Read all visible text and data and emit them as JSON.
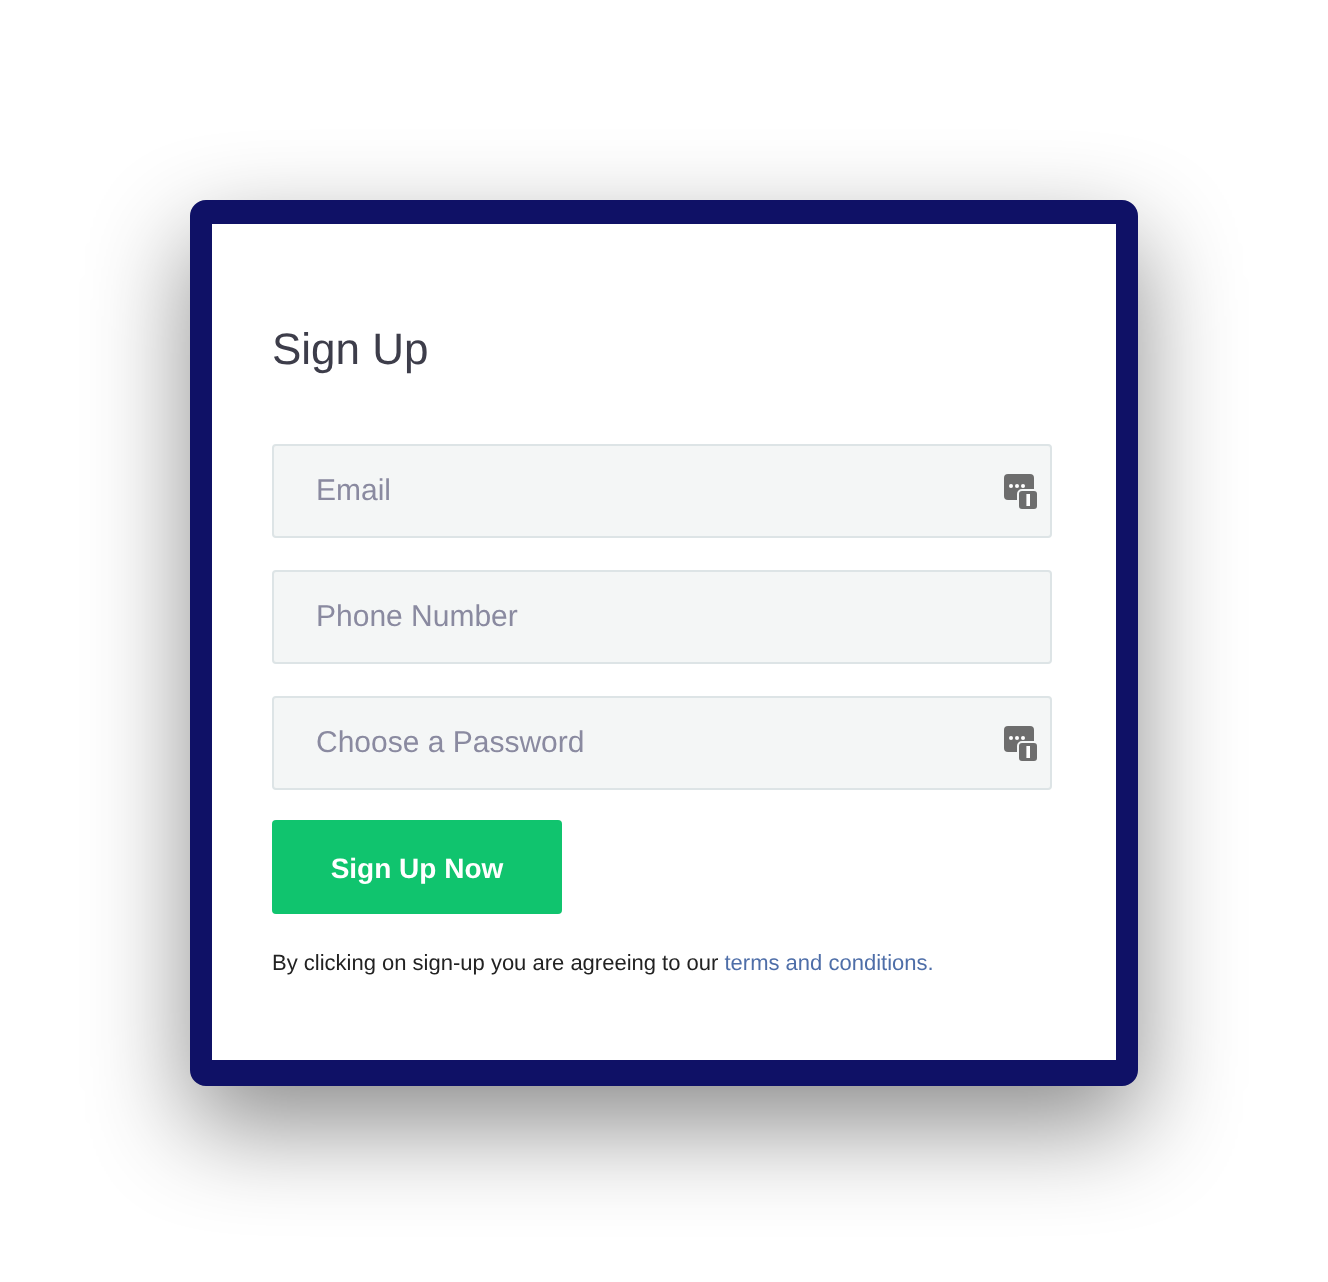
{
  "form": {
    "title": "Sign Up",
    "fields": [
      {
        "placeholder": "Email",
        "autofill_icon": true
      },
      {
        "placeholder": "Phone Number",
        "autofill_icon": false
      },
      {
        "placeholder": "Choose a Password",
        "autofill_icon": true
      }
    ],
    "submit": "Sign Up Now",
    "agreement": {
      "text": "By clicking on sign-up you are agreeing to our",
      "link": "terms and conditions."
    }
  }
}
